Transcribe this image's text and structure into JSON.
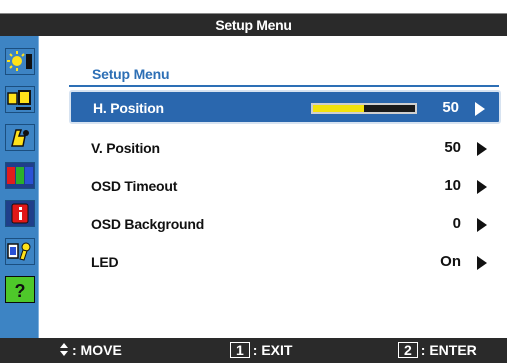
{
  "window_title": "Setup Menu",
  "panel_title": "Setup Menu",
  "sidebar": {
    "items": [
      {
        "icon": "brightness-icon",
        "selected": false
      },
      {
        "icon": "image-setup-icon",
        "selected": false
      },
      {
        "icon": "color-temp-icon",
        "selected": false
      },
      {
        "icon": "color-bars-icon",
        "selected": false
      },
      {
        "icon": "information-icon",
        "selected": false
      },
      {
        "icon": "setup-menu-icon",
        "selected": false
      },
      {
        "icon": "help-icon",
        "selected": true
      }
    ]
  },
  "menu": {
    "items": [
      {
        "label": "H. Position",
        "value": "50",
        "slider_fraction": 0.5,
        "selected": true
      },
      {
        "label": "V. Position",
        "value": "50"
      },
      {
        "label": "OSD Timeout",
        "value": "10"
      },
      {
        "label": "OSD Background",
        "value": "0"
      },
      {
        "label": "LED",
        "value": "On"
      }
    ]
  },
  "footer": {
    "move_label": ": MOVE",
    "exit_key": "1",
    "exit_label": ": EXIT",
    "enter_key": "2",
    "enter_label": ": ENTER"
  },
  "colors": {
    "sidebar_bg": "#3d84c4",
    "selected_row": "#2a67ae",
    "slider_fill": "#f3e20c",
    "bar_bg": "#2a2a2a",
    "help_tile": "#4ec82a"
  }
}
